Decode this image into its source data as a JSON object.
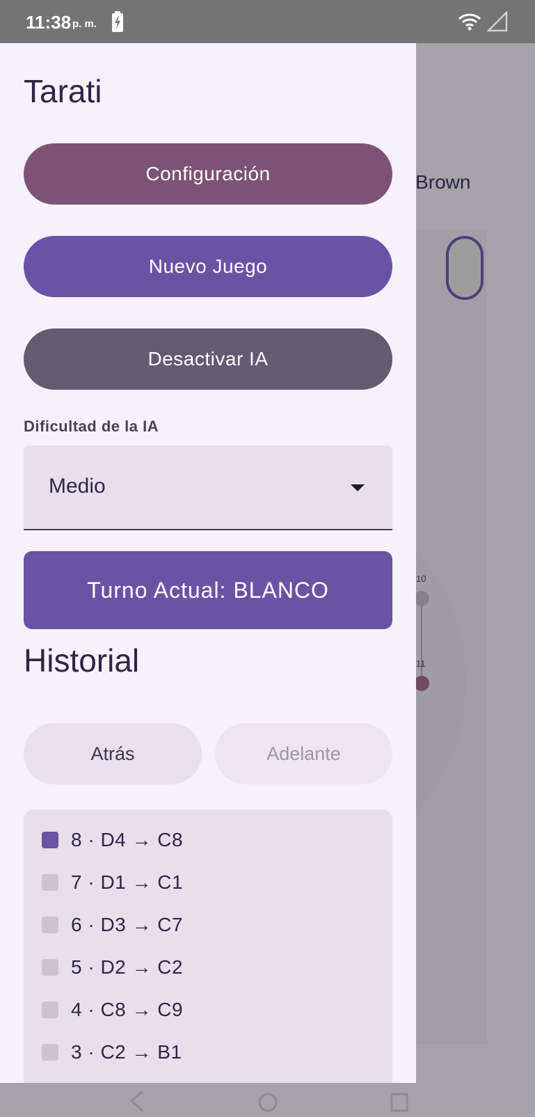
{
  "status_bar": {
    "time": "11:38",
    "ampm": "p. m."
  },
  "background_app": {
    "title_fragment": "r Brown",
    "board_labels": [
      "10",
      "11"
    ]
  },
  "drawer": {
    "title": "Tarati",
    "buttons": {
      "config": "Configuración",
      "new_game": "Nuevo Juego",
      "toggle_ai": "Desactivar IA"
    },
    "difficulty": {
      "label": "Dificultad de la IA",
      "selected": "Medio"
    },
    "turn": "Turno Actual: BLANCO",
    "history": {
      "title": "Historial",
      "back": "Atrás",
      "forward": "Adelante",
      "moves": [
        {
          "text": "8 · D4 → C8",
          "active": true
        },
        {
          "text": "7 · D1 → C1",
          "active": false
        },
        {
          "text": "6 · D3 → C7",
          "active": false
        },
        {
          "text": "5 · D2 → C2",
          "active": false
        },
        {
          "text": "4 · C8 → C9",
          "active": false
        },
        {
          "text": "3 · C2 → B1",
          "active": false
        }
      ]
    }
  },
  "colors": {
    "accent": "#6a52a4",
    "config_button": "#7d5275",
    "ai_button": "#635b70",
    "drawer_bg": "#f7f1fc"
  }
}
